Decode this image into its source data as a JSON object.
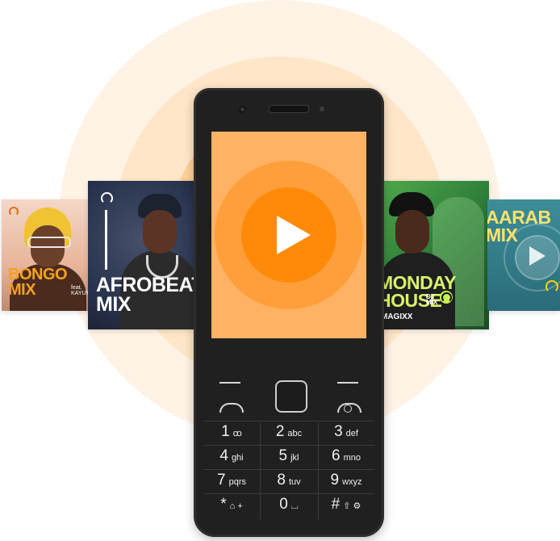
{
  "covers": {
    "bongo": {
      "title_line1": "BONGO",
      "title_line2": "MIX",
      "featured": "feat. KAYUM"
    },
    "afrobeats": {
      "title_line1": "AFROBEAT",
      "title_line2": "MIX"
    },
    "monday": {
      "title_line1": "MONDAY",
      "title_line2": "HOUSE",
      "dj": "DJ",
      "mix": "MIX",
      "artist": "MAGIXX"
    },
    "aarab": {
      "title_line1": "AARAB",
      "title_line2": "MIX"
    }
  },
  "icons": {
    "brand_logo": "headphones-logo-icon",
    "play": "play-icon",
    "call": "call-key-icon",
    "end": "end-call-icon",
    "nav": "navigation-pad-icon"
  },
  "colors": {
    "halo": "#ffe6c8",
    "screen_bg": "#ffb263",
    "play_circle": "#ff8a0a",
    "phone_body": "#202020",
    "bongo_accent": "#f5a21d",
    "monday_accent": "#d7f36b",
    "aarab_accent": "#ffe26b"
  },
  "keypad": [
    {
      "digit": "1",
      "letters": "ꝏ"
    },
    {
      "digit": "2",
      "letters": "abc"
    },
    {
      "digit": "3",
      "letters": "def"
    },
    {
      "digit": "4",
      "letters": "ghi"
    },
    {
      "digit": "5",
      "letters": "jkl"
    },
    {
      "digit": "6",
      "letters": "mno"
    },
    {
      "digit": "7",
      "letters": "pqrs"
    },
    {
      "digit": "8",
      "letters": "tuv"
    },
    {
      "digit": "9",
      "letters": "wxyz"
    },
    {
      "digit": "*",
      "letters": "⌂ +"
    },
    {
      "digit": "0",
      "letters": "⌴"
    },
    {
      "digit": "#",
      "letters": "⇧ ⚙"
    }
  ]
}
